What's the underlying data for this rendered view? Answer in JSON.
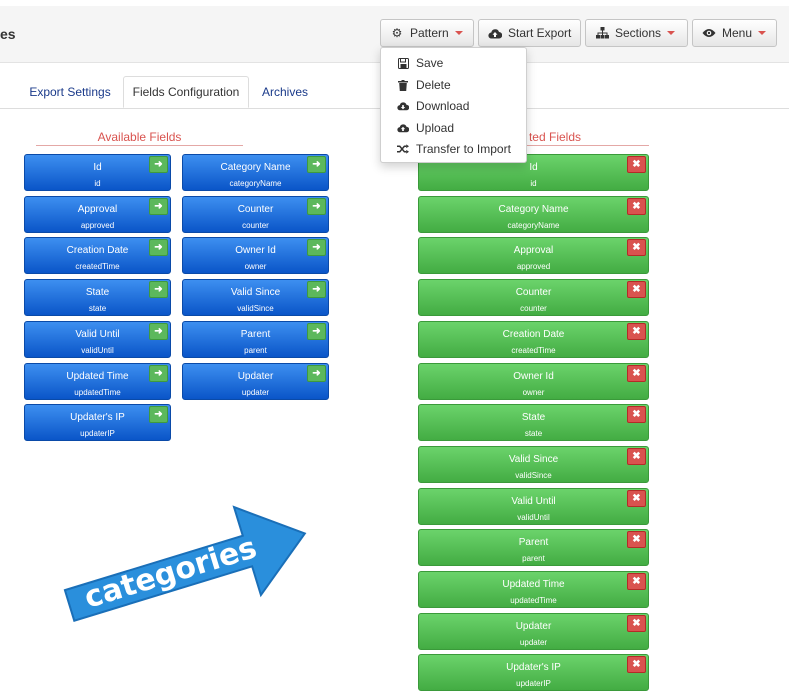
{
  "header": {
    "title": "es",
    "buttons": {
      "pattern": "Pattern",
      "start_export": "Start Export",
      "sections": "Sections",
      "menu": "Menu"
    }
  },
  "pattern_menu": {
    "items": [
      "Save",
      "Delete",
      "Download",
      "Upload",
      "Transfer to Import"
    ]
  },
  "tabs": [
    "Export Settings",
    "Fields Configuration",
    "Archives"
  ],
  "available": {
    "title": "Available Fields",
    "col1": [
      {
        "label": "Id",
        "key": "id"
      },
      {
        "label": "Approval",
        "key": "approved"
      },
      {
        "label": "Creation Date",
        "key": "createdTime"
      },
      {
        "label": "State",
        "key": "state"
      },
      {
        "label": "Valid Until",
        "key": "validUntil"
      },
      {
        "label": "Updated Time",
        "key": "updatedTime"
      },
      {
        "label": "Updater's IP",
        "key": "updaterIP"
      }
    ],
    "col2": [
      {
        "label": "Category Name",
        "key": "categoryName"
      },
      {
        "label": "Counter",
        "key": "counter"
      },
      {
        "label": "Owner Id",
        "key": "owner"
      },
      {
        "label": "Valid Since",
        "key": "validSince"
      },
      {
        "label": "Parent",
        "key": "parent"
      },
      {
        "label": "Updater",
        "key": "updater"
      }
    ],
    "add_symbol": "➜"
  },
  "selected": {
    "title": "ted Fields",
    "items": [
      {
        "label": "Id",
        "key": "id"
      },
      {
        "label": "Category Name",
        "key": "categoryName"
      },
      {
        "label": "Approval",
        "key": "approved"
      },
      {
        "label": "Counter",
        "key": "counter"
      },
      {
        "label": "Creation Date",
        "key": "createdTime"
      },
      {
        "label": "Owner Id",
        "key": "owner"
      },
      {
        "label": "State",
        "key": "state"
      },
      {
        "label": "Valid Since",
        "key": "validSince"
      },
      {
        "label": "Valid Until",
        "key": "validUntil"
      },
      {
        "label": "Parent",
        "key": "parent"
      },
      {
        "label": "Updated Time",
        "key": "updatedTime"
      },
      {
        "label": "Updater",
        "key": "updater"
      },
      {
        "label": "Updater's IP",
        "key": "updaterIP"
      }
    ],
    "remove_symbol": "✖"
  },
  "banner": {
    "text": "categories"
  },
  "colors": {
    "accent_red": "#d9534f",
    "field_blue": "#1565d8",
    "field_green": "#55bf55",
    "banner_blue": "#2a8fdc"
  },
  "icons": {
    "pattern": "gear-icon",
    "start_export": "cloud-upload-icon",
    "sections": "sitemap-icon",
    "menu": "eye-icon",
    "save": "floppy-icon",
    "delete": "trash-icon",
    "download": "cloud-download-icon",
    "upload": "cloud-upload-icon",
    "transfer": "shuffle-icon"
  }
}
